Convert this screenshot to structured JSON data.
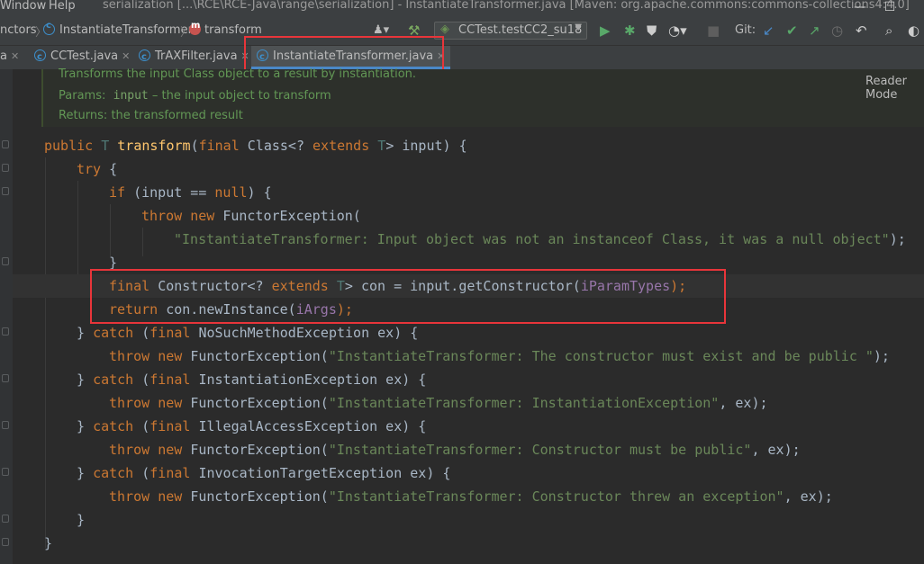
{
  "titlebar": {
    "menu_window": "Window",
    "menu_help": "Help",
    "title": "serialization [...\\RCE\\RCE-Java\\range\\serialization] - InstantiateTransformer.java [Maven: org.apache.commons:commons-collections4:4.0]",
    "minimize": "—",
    "maximize": "☐"
  },
  "navbar": {
    "crumb_functors": "nctors",
    "crumb_class": "InstantiateTransformer",
    "crumb_method": "transform",
    "run_config": "CCTest.testCC2_su18",
    "git_label": "Git:"
  },
  "tabs": [
    {
      "label": "a"
    },
    {
      "label": "CCTest.java"
    },
    {
      "label": "TrAXFilter.java"
    },
    {
      "label": "InstantiateTransformer.java"
    }
  ],
  "doc": {
    "summary": "Transforms the input Class object to a result by instantiation.",
    "params_label": "Params:",
    "params_name": "input",
    "params_desc": "– the input object to transform",
    "returns_label": "Returns:",
    "returns_desc": "the transformed result",
    "reader_mode": "Reader Mode"
  },
  "code": {
    "l1_public": "public ",
    "l1_T": "T ",
    "l1_fn": "transform",
    "l1_open": "(",
    "l1_final": "final ",
    "l1_class": "Class<? ",
    "l1_extends": "extends ",
    "l1_T2": "T",
    "l1_rest": "> input) {",
    "l2_try": "try",
    "l2_brace": " {",
    "l3_if": "if",
    "l3_mid": " (input == ",
    "l3_null": "null",
    "l3_end": ") {",
    "l4_throw": "throw ",
    "l4_new": "new ",
    "l4_rest": "FunctorException(",
    "l5_str": "\"InstantiateTransformer: Input object was not an instanceof Class, it was a null object\"",
    "l5_end": ");",
    "l6_brace": "}",
    "l7_final": "final ",
    "l7_ctor": "Constructor<? ",
    "l7_extends": "extends ",
    "l7_T": "T",
    "l7_mid": "> con = input.getConstructor(",
    "l7_field": "iParamTypes",
    "l7_end": ");",
    "l8_return": "return ",
    "l8_mid": "con.newInstance(",
    "l8_field": "iArgs",
    "l8_end": ");",
    "c1_open": "} ",
    "c1_catch": "catch",
    "c1_mid": " (",
    "c1_final": "final ",
    "c1_type": "NoSuchMethodException ex) {",
    "c1_throw": "throw ",
    "c1_new": "new ",
    "c1_ctor": "FunctorException(",
    "c1_str": "\"InstantiateTransformer: The constructor must exist and be public \"",
    "c1_end": ");",
    "c2_type": "InstantiationException ex) {",
    "c2_str": "\"InstantiateTransformer: InstantiationException\"",
    "c2_end": ", ex);",
    "c3_type": "IllegalAccessException ex) {",
    "c3_str": "\"InstantiateTransformer: Constructor must be public\"",
    "c3_end": ", ex);",
    "c4_type": "InvocationTargetException ex) {",
    "c4_str": "\"InstantiateTransformer: Constructor threw an exception\"",
    "c4_end": ", ex);",
    "close_inner": "}",
    "close_outer": "}"
  }
}
